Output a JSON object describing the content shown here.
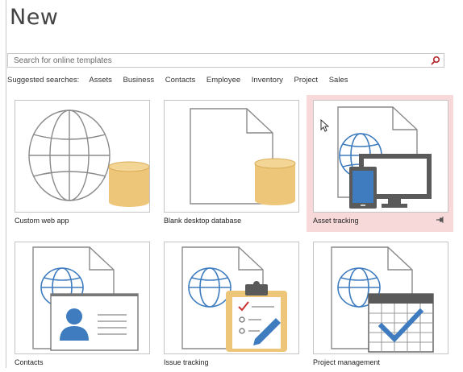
{
  "page": {
    "title": "New"
  },
  "search": {
    "placeholder": "Search for online templates"
  },
  "suggested": {
    "label": "Suggested searches:",
    "items": [
      "Assets",
      "Business",
      "Contacts",
      "Employee",
      "Inventory",
      "Project",
      "Sales"
    ]
  },
  "templates": [
    {
      "label": "Custom web app"
    },
    {
      "label": "Blank desktop database"
    },
    {
      "label": "Asset tracking"
    },
    {
      "label": "Contacts"
    },
    {
      "label": "Issue tracking"
    },
    {
      "label": "Project management"
    }
  ],
  "colors": {
    "highlight": "#f7d9d9",
    "globe_blue": "#3e7cbf",
    "db_gold": "#eec679",
    "device_gray": "#5a5a5a",
    "check_blue": "#3e7cbf"
  }
}
